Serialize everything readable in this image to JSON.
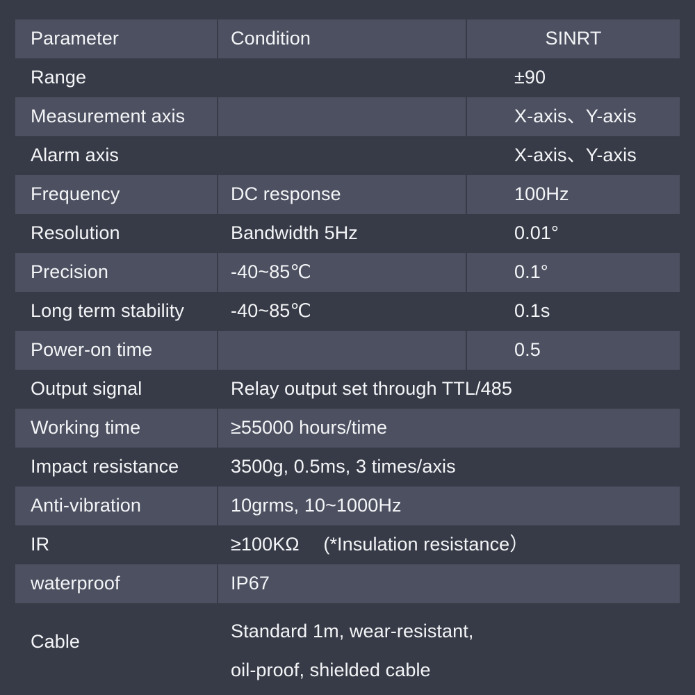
{
  "table": {
    "columns": [
      "Parameter",
      "Condition",
      "SINRT"
    ],
    "rows": [
      {
        "parameter": "Parameter",
        "condition": "Condition",
        "value": "SINRT",
        "header": true
      },
      {
        "parameter": "Range",
        "condition": "",
        "value": "±90"
      },
      {
        "parameter": "Measurement axis",
        "condition": "",
        "value": "X-axis、Y-axis"
      },
      {
        "parameter": "Alarm axis",
        "condition": "",
        "value": "X-axis、Y-axis"
      },
      {
        "parameter": "Frequency",
        "condition": "DC response",
        "value": "100Hz"
      },
      {
        "parameter": "Resolution",
        "condition": "Bandwidth 5Hz",
        "value": "0.01°"
      },
      {
        "parameter": "Precision",
        "condition": "-40~85℃",
        "value": "0.1°"
      },
      {
        "parameter": "Long term stability",
        "condition": "-40~85℃",
        "value": "0.1s"
      },
      {
        "parameter": "Power-on time",
        "condition": "",
        "value": "0.5"
      },
      {
        "parameter": "Output signal",
        "merged": "Relay output set through TTL/485"
      },
      {
        "parameter": "Working time",
        "merged": "≥55000 hours/time"
      },
      {
        "parameter": "Impact resistance",
        "merged": "3500g, 0.5ms, 3 times/axis"
      },
      {
        "parameter": "Anti-vibration",
        "merged": "10grms, 10~1000Hz"
      },
      {
        "parameter": "IR",
        "merged": "≥100KΩ　 (*Insulation resistance）"
      },
      {
        "parameter": "waterproof",
        "merged": "IP67"
      },
      {
        "parameter": "Cable",
        "merged_lines": [
          "Standard 1m, wear-resistant,",
          "oil-proof, shielded cable"
        ]
      }
    ]
  },
  "colors": {
    "background": "#373b47",
    "band": "#4c5060",
    "text": "#f4f5f7"
  }
}
